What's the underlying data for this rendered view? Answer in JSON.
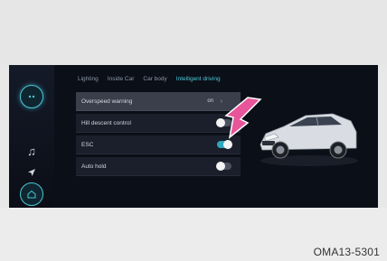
{
  "tabs": [
    "Lighting",
    "Inside Car",
    "Car body",
    "Intelligent driving"
  ],
  "settings": [
    {
      "label": "Overspeed warning",
      "value": "on"
    },
    {
      "label": "Hill descent control",
      "toggle": "off"
    },
    {
      "label": "ESC",
      "toggle": "on"
    },
    {
      "label": "Auto hold",
      "toggle": "off"
    }
  ],
  "caption": "OMA13-5301",
  "colors": {
    "accent": "#4fc9d8",
    "screen_bg": "#0b0f18",
    "arrow": "#e8559a"
  },
  "icons": [
    "assistant-icon",
    "music-icon",
    "navigation-icon",
    "home-icon",
    "chevron-right-icon",
    "car-image"
  ]
}
